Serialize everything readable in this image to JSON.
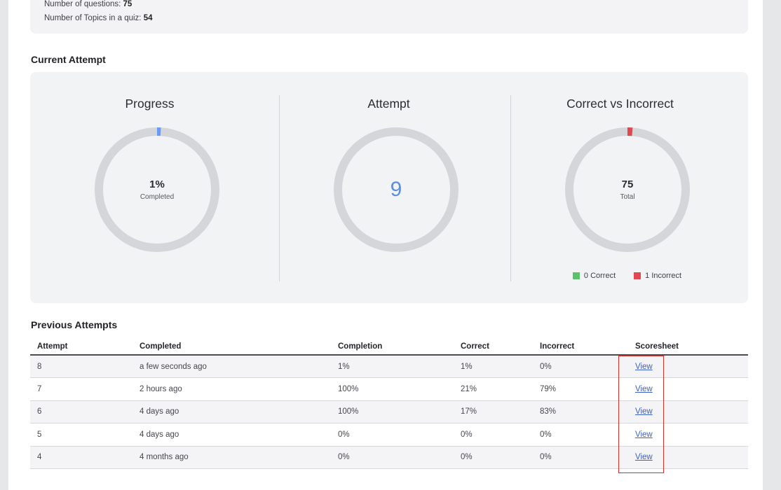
{
  "summary": {
    "questions_label": "Number of questions:",
    "questions_value": "75",
    "topics_label": "Number of Topics in a quiz:",
    "topics_value": "54"
  },
  "current_attempt": {
    "heading": "Current Attempt",
    "progress": {
      "title": "Progress",
      "value": "1%",
      "caption": "Completed",
      "percent": 1,
      "color": "#6b9af0"
    },
    "attempt": {
      "title": "Attempt",
      "value": "9",
      "color": "#5b8ee0"
    },
    "correct_vs_incorrect": {
      "title": "Correct vs Incorrect",
      "value": "75",
      "caption": "Total",
      "correct_count": 0,
      "incorrect_count": 1,
      "total": 75,
      "correct_color": "#5cc26a",
      "incorrect_color": "#e0474f",
      "legend": {
        "correct_label": "0 Correct",
        "incorrect_label": "1 Incorrect"
      }
    },
    "ring_track_color": "#d5d6d9"
  },
  "previous_attempts": {
    "heading": "Previous Attempts",
    "columns": [
      "Attempt",
      "Completed",
      "Completion",
      "Correct",
      "Incorrect",
      "Scoresheet"
    ],
    "rows": [
      {
        "attempt": "8",
        "completed": "a few seconds ago",
        "completion": "1%",
        "correct": "1%",
        "incorrect": "0%",
        "scoresheet": "View"
      },
      {
        "attempt": "7",
        "completed": "2 hours ago",
        "completion": "100%",
        "correct": "21%",
        "incorrect": "79%",
        "scoresheet": "View"
      },
      {
        "attempt": "6",
        "completed": "4 days ago",
        "completion": "100%",
        "correct": "17%",
        "incorrect": "83%",
        "scoresheet": "View"
      },
      {
        "attempt": "5",
        "completed": "4 days ago",
        "completion": "0%",
        "correct": "0%",
        "incorrect": "0%",
        "scoresheet": "View"
      },
      {
        "attempt": "4",
        "completed": "4 months ago",
        "completion": "0%",
        "correct": "0%",
        "incorrect": "0%",
        "scoresheet": "View"
      }
    ]
  }
}
